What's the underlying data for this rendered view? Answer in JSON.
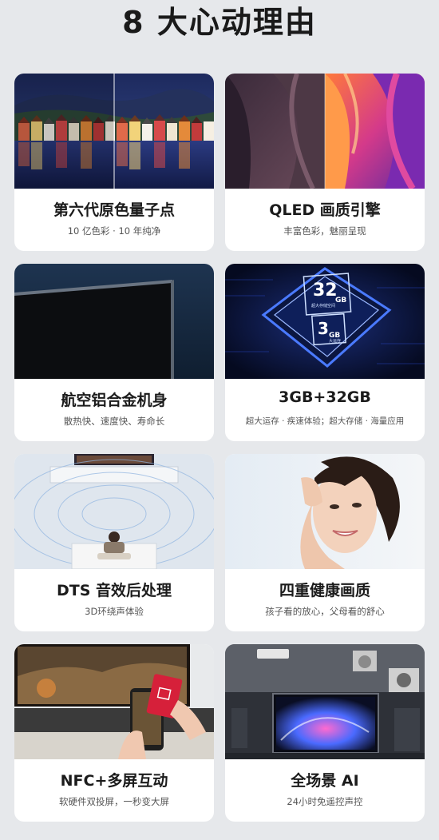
{
  "page": {
    "title": "8 大心动理由"
  },
  "features": [
    {
      "title": "第六代原色量子点",
      "subtitle": "10 亿色彩 · 10 年纯净"
    },
    {
      "title": "QLED 画质引擎",
      "subtitle": "丰富色彩，魅丽呈现"
    },
    {
      "title": "航空铝合金机身",
      "subtitle": "散热快、速度快、寿命长"
    },
    {
      "title": "3GB+32GB",
      "subtitle": "超大运存 · 疾速体验；超大存储 · 海量应用"
    },
    {
      "title": "DTS 音效后处理",
      "subtitle": "3D环绕声体验"
    },
    {
      "title": "四重健康画质",
      "subtitle": "孩子看的放心，父母看的舒心"
    },
    {
      "title": "NFC+多屏互动",
      "subtitle": "软硬件双投屏，一秒变大屏"
    },
    {
      "title": "全场景 AI",
      "subtitle": "24小时免遥控声控"
    }
  ],
  "chip": {
    "storage": "32",
    "storage_unit": "GB",
    "storage_label": "超大存储空间",
    "ram": "3",
    "ram_unit": "GB",
    "ram_label": "大运存"
  },
  "colors": {
    "background": "#e6e8eb",
    "card": "#ffffff",
    "title": "#1a1a1a",
    "chip_glow": "#3b6bff"
  },
  "icons": {
    "nfc_card": "red-nfc-card"
  }
}
